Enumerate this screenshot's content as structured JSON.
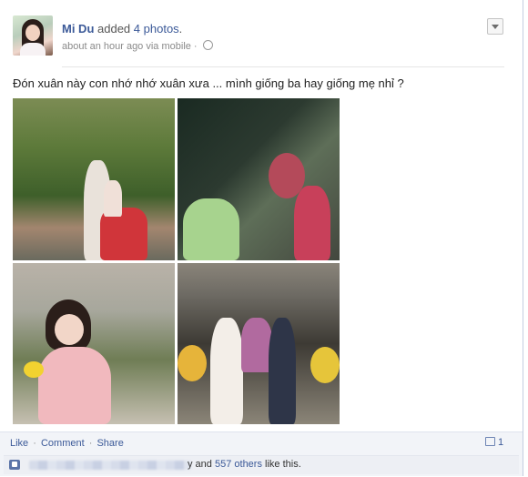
{
  "post": {
    "author": "Mi Du",
    "action": "added",
    "photo_link": "4 photos",
    "period": ".",
    "meta": "about an hour ago via mobile ·",
    "status_text": "Đón xuân này con nhớ nhớ xuân xưa ... mình giống ba hay giống mẹ nhỉ ?",
    "icons": {
      "globe": "globe-icon",
      "chevron": "chevron-down-icon",
      "comment": "comment-icon",
      "like": "thumbs-up-icon"
    }
  },
  "photos": [
    {
      "name": "family photo on scooter"
    },
    {
      "name": "mother handing flowers to child"
    },
    {
      "name": "girl in pink dress with flowers"
    },
    {
      "name": "family portrait at doorway"
    }
  ],
  "footer": {
    "like": "Like",
    "comment": "Comment",
    "share": "Share",
    "separator": "·",
    "comment_count": "1",
    "likes_prefix": "y and",
    "likes_others": "557 others",
    "likes_suffix": "like this."
  },
  "colors": {
    "link": "#3b5998",
    "footer_bg": "#f2f4f8",
    "likes_bg": "#edeff4"
  }
}
